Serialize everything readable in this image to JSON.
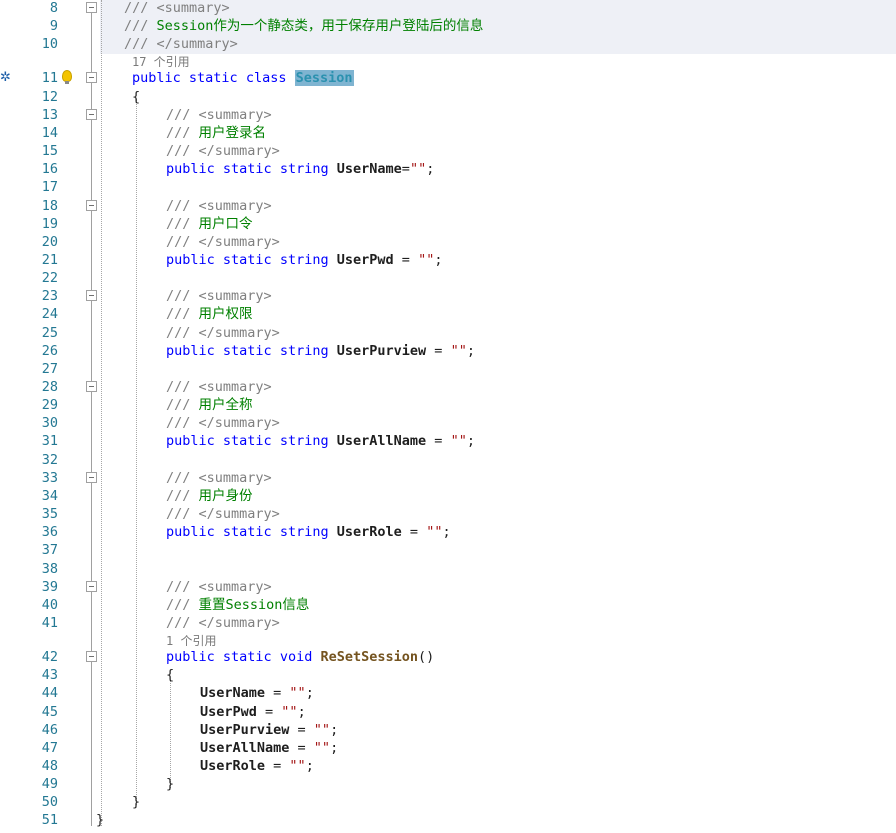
{
  "editor": {
    "lines": [
      {
        "num": "8",
        "fold": true,
        "indent": 0,
        "tokens": [
          {
            "t": "/// ",
            "c": "doc"
          },
          {
            "t": "<summary>",
            "c": "doc"
          }
        ]
      },
      {
        "num": "9",
        "fold": false,
        "indent": 0,
        "tokens": [
          {
            "t": "/// ",
            "c": "doc"
          },
          {
            "t": "Session作为一个静态类，用于保存用户登陆后的信息",
            "c": "com"
          }
        ]
      },
      {
        "num": "10",
        "fold": false,
        "indent": 0,
        "tokens": [
          {
            "t": "/// ",
            "c": "doc"
          },
          {
            "t": "</summary>",
            "c": "doc"
          }
        ]
      },
      {
        "ref": "17 个引用",
        "indent": 1
      },
      {
        "num": "11",
        "fold": true,
        "indent": 1,
        "tokens": [
          {
            "t": "public",
            "c": "kw"
          },
          {
            "t": " "
          },
          {
            "t": "static",
            "c": "kw"
          },
          {
            "t": " "
          },
          {
            "t": "class",
            "c": "kw"
          },
          {
            "t": " "
          },
          {
            "t": "Session",
            "c": "cls"
          }
        ]
      },
      {
        "num": "12",
        "fold": false,
        "indent": 1,
        "tokens": [
          {
            "t": "{"
          }
        ]
      },
      {
        "num": "13",
        "fold": true,
        "indent": 2,
        "tokens": [
          {
            "t": "/// ",
            "c": "doc"
          },
          {
            "t": "<summary>",
            "c": "doc"
          }
        ]
      },
      {
        "num": "14",
        "fold": false,
        "indent": 2,
        "tokens": [
          {
            "t": "/// ",
            "c": "doc"
          },
          {
            "t": "用户登录名",
            "c": "com"
          }
        ]
      },
      {
        "num": "15",
        "fold": false,
        "indent": 2,
        "tokens": [
          {
            "t": "/// ",
            "c": "doc"
          },
          {
            "t": "</summary>",
            "c": "doc"
          }
        ]
      },
      {
        "num": "16",
        "fold": false,
        "indent": 2,
        "tokens": [
          {
            "t": "public",
            "c": "kw"
          },
          {
            "t": " "
          },
          {
            "t": "static",
            "c": "kw"
          },
          {
            "t": " "
          },
          {
            "t": "string",
            "c": "kw"
          },
          {
            "t": " "
          },
          {
            "t": "UserName",
            "c": "bold"
          },
          {
            "t": "="
          },
          {
            "t": "\"\"",
            "c": "str"
          },
          {
            "t": ";"
          }
        ]
      },
      {
        "num": "17",
        "fold": false,
        "indent": 2,
        "tokens": []
      },
      {
        "num": "18",
        "fold": true,
        "indent": 2,
        "tokens": [
          {
            "t": "/// ",
            "c": "doc"
          },
          {
            "t": "<summary>",
            "c": "doc"
          }
        ]
      },
      {
        "num": "19",
        "fold": false,
        "indent": 2,
        "tokens": [
          {
            "t": "/// ",
            "c": "doc"
          },
          {
            "t": "用户口令",
            "c": "com"
          }
        ]
      },
      {
        "num": "20",
        "fold": false,
        "indent": 2,
        "tokens": [
          {
            "t": "/// ",
            "c": "doc"
          },
          {
            "t": "</summary>",
            "c": "doc"
          }
        ]
      },
      {
        "num": "21",
        "fold": false,
        "indent": 2,
        "tokens": [
          {
            "t": "public",
            "c": "kw"
          },
          {
            "t": " "
          },
          {
            "t": "static",
            "c": "kw"
          },
          {
            "t": " "
          },
          {
            "t": "string",
            "c": "kw"
          },
          {
            "t": " "
          },
          {
            "t": "UserPwd",
            "c": "bold"
          },
          {
            "t": " = "
          },
          {
            "t": "\"\"",
            "c": "str"
          },
          {
            "t": ";"
          }
        ]
      },
      {
        "num": "22",
        "fold": false,
        "indent": 2,
        "tokens": []
      },
      {
        "num": "23",
        "fold": true,
        "indent": 2,
        "tokens": [
          {
            "t": "/// ",
            "c": "doc"
          },
          {
            "t": "<summary>",
            "c": "doc"
          }
        ]
      },
      {
        "num": "24",
        "fold": false,
        "indent": 2,
        "tokens": [
          {
            "t": "/// ",
            "c": "doc"
          },
          {
            "t": "用户权限",
            "c": "com"
          }
        ]
      },
      {
        "num": "25",
        "fold": false,
        "indent": 2,
        "tokens": [
          {
            "t": "/// ",
            "c": "doc"
          },
          {
            "t": "</summary>",
            "c": "doc"
          }
        ]
      },
      {
        "num": "26",
        "fold": false,
        "indent": 2,
        "tokens": [
          {
            "t": "public",
            "c": "kw"
          },
          {
            "t": " "
          },
          {
            "t": "static",
            "c": "kw"
          },
          {
            "t": " "
          },
          {
            "t": "string",
            "c": "kw"
          },
          {
            "t": " "
          },
          {
            "t": "UserPurview",
            "c": "bold"
          },
          {
            "t": " = "
          },
          {
            "t": "\"\"",
            "c": "str"
          },
          {
            "t": ";"
          }
        ]
      },
      {
        "num": "27",
        "fold": false,
        "indent": 2,
        "tokens": []
      },
      {
        "num": "28",
        "fold": true,
        "indent": 2,
        "tokens": [
          {
            "t": "/// ",
            "c": "doc"
          },
          {
            "t": "<summary>",
            "c": "doc"
          }
        ]
      },
      {
        "num": "29",
        "fold": false,
        "indent": 2,
        "tokens": [
          {
            "t": "/// ",
            "c": "doc"
          },
          {
            "t": "用户全称",
            "c": "com"
          }
        ]
      },
      {
        "num": "30",
        "fold": false,
        "indent": 2,
        "tokens": [
          {
            "t": "/// ",
            "c": "doc"
          },
          {
            "t": "</summary>",
            "c": "doc"
          }
        ]
      },
      {
        "num": "31",
        "fold": false,
        "indent": 2,
        "tokens": [
          {
            "t": "public",
            "c": "kw"
          },
          {
            "t": " "
          },
          {
            "t": "static",
            "c": "kw"
          },
          {
            "t": " "
          },
          {
            "t": "string",
            "c": "kw"
          },
          {
            "t": " "
          },
          {
            "t": "UserAllName",
            "c": "bold"
          },
          {
            "t": " = "
          },
          {
            "t": "\"\"",
            "c": "str"
          },
          {
            "t": ";"
          }
        ]
      },
      {
        "num": "32",
        "fold": false,
        "indent": 2,
        "tokens": []
      },
      {
        "num": "33",
        "fold": true,
        "indent": 2,
        "tokens": [
          {
            "t": "/// ",
            "c": "doc"
          },
          {
            "t": "<summary>",
            "c": "doc"
          }
        ]
      },
      {
        "num": "34",
        "fold": false,
        "indent": 2,
        "tokens": [
          {
            "t": "/// ",
            "c": "doc"
          },
          {
            "t": "用户身份",
            "c": "com"
          }
        ]
      },
      {
        "num": "35",
        "fold": false,
        "indent": 2,
        "tokens": [
          {
            "t": "/// ",
            "c": "doc"
          },
          {
            "t": "</summary>",
            "c": "doc"
          }
        ]
      },
      {
        "num": "36",
        "fold": false,
        "indent": 2,
        "tokens": [
          {
            "t": "public",
            "c": "kw"
          },
          {
            "t": " "
          },
          {
            "t": "static",
            "c": "kw"
          },
          {
            "t": " "
          },
          {
            "t": "string",
            "c": "kw"
          },
          {
            "t": " "
          },
          {
            "t": "UserRole",
            "c": "bold"
          },
          {
            "t": " = "
          },
          {
            "t": "\"\"",
            "c": "str"
          },
          {
            "t": ";"
          }
        ]
      },
      {
        "num": "37",
        "fold": false,
        "indent": 2,
        "tokens": []
      },
      {
        "num": "38",
        "fold": false,
        "indent": 2,
        "tokens": []
      },
      {
        "num": "39",
        "fold": true,
        "indent": 2,
        "tokens": [
          {
            "t": "/// ",
            "c": "doc"
          },
          {
            "t": "<summary>",
            "c": "doc"
          }
        ]
      },
      {
        "num": "40",
        "fold": false,
        "indent": 2,
        "tokens": [
          {
            "t": "/// ",
            "c": "doc"
          },
          {
            "t": "重置Session信息",
            "c": "com"
          }
        ]
      },
      {
        "num": "41",
        "fold": false,
        "indent": 2,
        "tokens": [
          {
            "t": "/// ",
            "c": "doc"
          },
          {
            "t": "</summary>",
            "c": "doc"
          }
        ]
      },
      {
        "ref": "1 个引用",
        "indent": 2
      },
      {
        "num": "42",
        "fold": true,
        "indent": 2,
        "tokens": [
          {
            "t": "public",
            "c": "kw"
          },
          {
            "t": " "
          },
          {
            "t": "static",
            "c": "kw"
          },
          {
            "t": " "
          },
          {
            "t": "void",
            "c": "kw"
          },
          {
            "t": " "
          },
          {
            "t": "ReSetSession",
            "c": "mth"
          },
          {
            "t": "()"
          }
        ]
      },
      {
        "num": "43",
        "fold": false,
        "indent": 2,
        "tokens": [
          {
            "t": "{"
          }
        ]
      },
      {
        "num": "44",
        "fold": false,
        "indent": 3,
        "tokens": [
          {
            "t": "UserName",
            "c": "bold"
          },
          {
            "t": " = "
          },
          {
            "t": "\"\"",
            "c": "str"
          },
          {
            "t": ";"
          }
        ]
      },
      {
        "num": "45",
        "fold": false,
        "indent": 3,
        "tokens": [
          {
            "t": "UserPwd",
            "c": "bold"
          },
          {
            "t": " = "
          },
          {
            "t": "\"\"",
            "c": "str"
          },
          {
            "t": ";"
          }
        ]
      },
      {
        "num": "46",
        "fold": false,
        "indent": 3,
        "tokens": [
          {
            "t": "UserPurview",
            "c": "bold"
          },
          {
            "t": " = "
          },
          {
            "t": "\"\"",
            "c": "str"
          },
          {
            "t": ";"
          }
        ]
      },
      {
        "num": "47",
        "fold": false,
        "indent": 3,
        "tokens": [
          {
            "t": "UserAllName",
            "c": "bold"
          },
          {
            "t": " = "
          },
          {
            "t": "\"\"",
            "c": "str"
          },
          {
            "t": ";"
          }
        ]
      },
      {
        "num": "48",
        "fold": false,
        "indent": 3,
        "tokens": [
          {
            "t": "UserRole",
            "c": "bold"
          },
          {
            "t": " = "
          },
          {
            "t": "\"\"",
            "c": "str"
          },
          {
            "t": ";"
          }
        ]
      },
      {
        "num": "49",
        "fold": false,
        "indent": 2,
        "tokens": [
          {
            "t": "}"
          }
        ]
      },
      {
        "num": "50",
        "fold": false,
        "indent": 1,
        "tokens": [
          {
            "t": "}"
          }
        ]
      },
      {
        "num": "51",
        "fold": false,
        "indent": -1,
        "tokens": [
          {
            "t": "}"
          }
        ]
      }
    ],
    "icons": {
      "lightbulb": "lightbulb-icon",
      "bookmark": "code-map-icon"
    },
    "colors": {
      "keyword": "#0000ff",
      "comment": "#008000",
      "doc_tag": "#808080",
      "string": "#a31515",
      "class_name": "#2b91af",
      "method": "#74531f",
      "line_number": "#237893"
    }
  }
}
